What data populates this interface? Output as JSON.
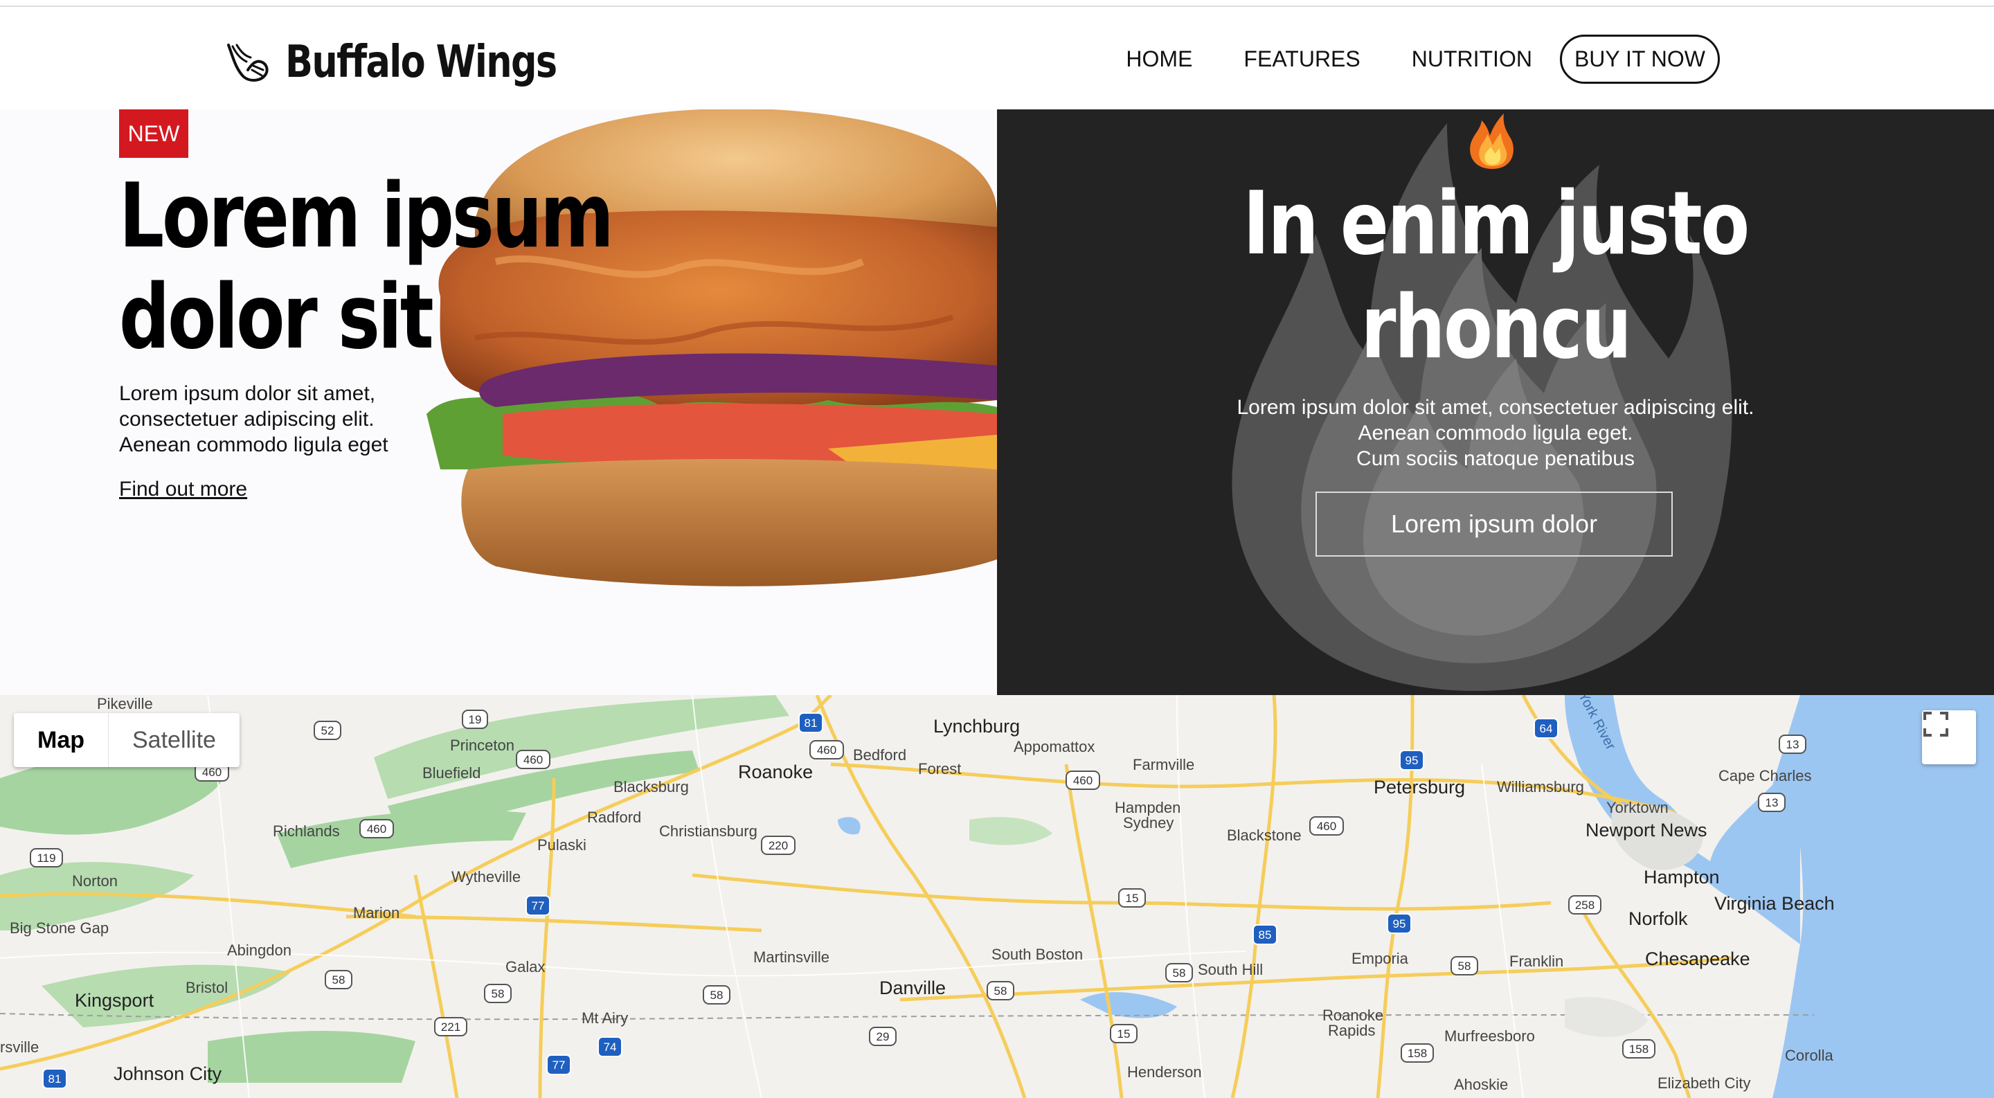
{
  "header": {
    "brand_name": "Buffalo Wings",
    "nav": [
      {
        "label": "HOME"
      },
      {
        "label": "FEATURES"
      },
      {
        "label": "NUTRITION"
      }
    ],
    "cta_label": "BUY IT NOW"
  },
  "hero_left": {
    "badge": "NEW",
    "title_line1": "Lorem ipsum",
    "title_line2": "dolor sit",
    "text_line1": "Lorem ipsum dolor sit amet,",
    "text_line2": "consectetuer adipiscing elit.",
    "text_line3": "Aenean commodo ligula eget",
    "link": "Find out more"
  },
  "hero_right": {
    "title_line1": "In enim justo",
    "title_line2": "rhoncu",
    "text_line1": "Lorem ipsum dolor sit amet, consectetuer adipiscing elit.",
    "text_line2": "Aenean commodo ligula eget.",
    "text_line3": "Cum sociis natoque penatibus",
    "button": "Lorem ipsum dolor"
  },
  "map": {
    "type_map": "Map",
    "type_satellite": "Satellite",
    "places": {
      "pikeville": "Pikeville",
      "princeton": "Princeton",
      "bluefield": "Bluefield",
      "blacksburg": "Blacksburg",
      "roanoke": "Roanoke",
      "lynchburg": "Lynchburg",
      "bedford": "Bedford",
      "forest": "Forest",
      "appomattox": "Appomattox",
      "farmville": "Farmville",
      "petersburg": "Petersburg",
      "williamsburg": "Williamsburg",
      "york_river": "York River",
      "cape_charles": "Cape Charles",
      "yorktown": "Yorktown",
      "newport_news": "Newport News",
      "hampton": "Hampton",
      "norfolk": "Norfolk",
      "virginia_beach": "Virginia Beach",
      "chesapeake": "Chesapeake",
      "richlands": "Richlands",
      "radford": "Radford",
      "christiansburg": "Christiansburg",
      "pulaski": "Pulaski",
      "hampden_sydney_1": "Hampden",
      "hampden_sydney_2": "Sydney",
      "blackstone": "Blackstone",
      "norton": "Norton",
      "wytheville": "Wytheville",
      "marion": "Marion",
      "big_stone_gap": "Big Stone Gap",
      "abingdon": "Abingdon",
      "bristol": "Bristol",
      "kingsport": "Kingsport",
      "galax": "Galax",
      "martinsville": "Martinsville",
      "danville": "Danville",
      "south_boston": "South Boston",
      "south_hill": "South Hill",
      "emporia": "Emporia",
      "franklin": "Franklin",
      "mt_airy": "Mt Airy",
      "roanoke_rapids_1": "Roanoke",
      "roanoke_rapids_2": "Rapids",
      "murfreesboro": "Murfreesboro",
      "corolla": "Corolla",
      "rsville": "rsville",
      "johnson_city": "Johnson City",
      "henderson": "Henderson",
      "ahoskie": "Ahoskie",
      "elizabeth_city": "Elizabeth City"
    },
    "shields": {
      "s52": "52",
      "s19": "19",
      "s460a": "460",
      "s460b": "460",
      "s81a": "81",
      "s460c": "460",
      "s95a": "95",
      "s64": "64",
      "s13a": "13",
      "s460d": "460",
      "s13b": "13",
      "s460e": "460",
      "s460f": "460",
      "s220": "220",
      "s119": "119",
      "s77a": "77",
      "s15a": "15",
      "s258": "258",
      "s85": "85",
      "s95b": "95",
      "s58a": "58",
      "s58b": "58",
      "s58c": "58",
      "s58d": "58",
      "s58e": "58",
      "s58f": "58",
      "s221": "221",
      "s77b": "77",
      "s74": "74",
      "s29": "29",
      "s15b": "15",
      "s158a": "158",
      "s158b": "158",
      "s81b": "81"
    }
  }
}
